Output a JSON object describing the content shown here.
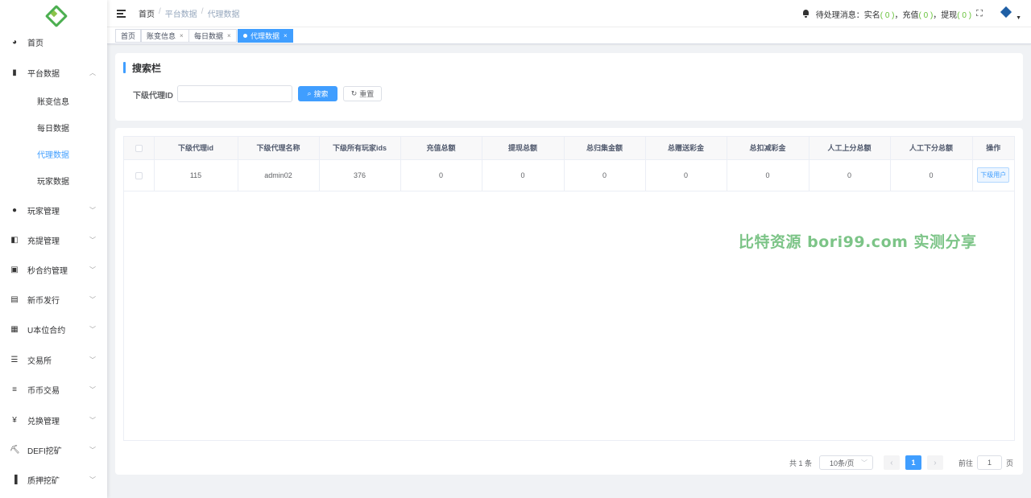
{
  "sidebar": {
    "menu": [
      {
        "icon": "dashboard-icon",
        "glyph": "◕",
        "label": "首页",
        "arrow": ""
      },
      {
        "icon": "book-icon",
        "glyph": "▮",
        "label": "平台数据",
        "arrow": "︿"
      },
      {
        "icon": "user-icon",
        "glyph": "●",
        "label": "玩家管理",
        "arrow": "﹀"
      },
      {
        "icon": "copy-icon",
        "glyph": "◧",
        "label": "充提管理",
        "arrow": "﹀"
      },
      {
        "icon": "monitor-icon",
        "glyph": "▣",
        "label": "秒合约管理",
        "arrow": "﹀"
      },
      {
        "icon": "card-icon",
        "glyph": "▤",
        "label": "新币发行",
        "arrow": "﹀"
      },
      {
        "icon": "grid-icon",
        "glyph": "▦",
        "label": "U本位合约",
        "arrow": "﹀"
      },
      {
        "icon": "list-icon",
        "glyph": "☰",
        "label": "交易所",
        "arrow": "﹀"
      },
      {
        "icon": "menu-list-icon",
        "glyph": "≡",
        "label": "币币交易",
        "arrow": "﹀"
      },
      {
        "icon": "yen-icon",
        "glyph": "¥",
        "label": "兑换管理",
        "arrow": "﹀"
      },
      {
        "icon": "mining-icon",
        "glyph": "⛏",
        "label": "DEFI挖矿",
        "arrow": "﹀"
      },
      {
        "icon": "bar-chart-icon",
        "glyph": "▐",
        "label": "质押挖矿",
        "arrow": "﹀"
      }
    ],
    "submenu": [
      "账变信息",
      "每日数据",
      "代理数据",
      "玩家数据"
    ]
  },
  "header": {
    "breadcrumb": [
      "首页",
      "平台数据",
      "代理数据"
    ],
    "pending_prefix": "待处理消息：实名",
    "pending_realname": "( 0 )",
    "pending_mid1": "，充值",
    "pending_recharge": "( 0 )",
    "pending_mid2": "，提现",
    "pending_withdraw": "( 0 )"
  },
  "tags": [
    {
      "label": "首页",
      "closable": false
    },
    {
      "label": "账变信息",
      "closable": true
    },
    {
      "label": "每日数据",
      "closable": true
    },
    {
      "label": "代理数据",
      "closable": true,
      "active": true
    }
  ],
  "search": {
    "title": "搜索栏",
    "field_label": "下级代理ID",
    "field_value": "",
    "search_button": "搜索",
    "reset_button": "重置"
  },
  "table": {
    "columns": [
      "",
      "下级代理id",
      "下级代理名称",
      "下级所有玩家ids",
      "充值总额",
      "提现总额",
      "总归集金额",
      "总赠送彩金",
      "总扣减彩金",
      "人工上分总额",
      "人工下分总额",
      "操作"
    ],
    "rows": [
      [
        "",
        "115",
        "admin02",
        "376",
        "0",
        "0",
        "0",
        "0",
        "0",
        "0",
        "0",
        "下级用户"
      ]
    ]
  },
  "watermark": "比特资源 bori99.com 实测分享",
  "pagination": {
    "total": "共 1 条",
    "page_size": "10条/页",
    "current": "1",
    "goto_label": "前往",
    "goto_value": "1",
    "goto_suffix": "页"
  },
  "colors": {
    "primary": "#409eff",
    "success": "#67c23a",
    "watermark": "#7cc487"
  }
}
